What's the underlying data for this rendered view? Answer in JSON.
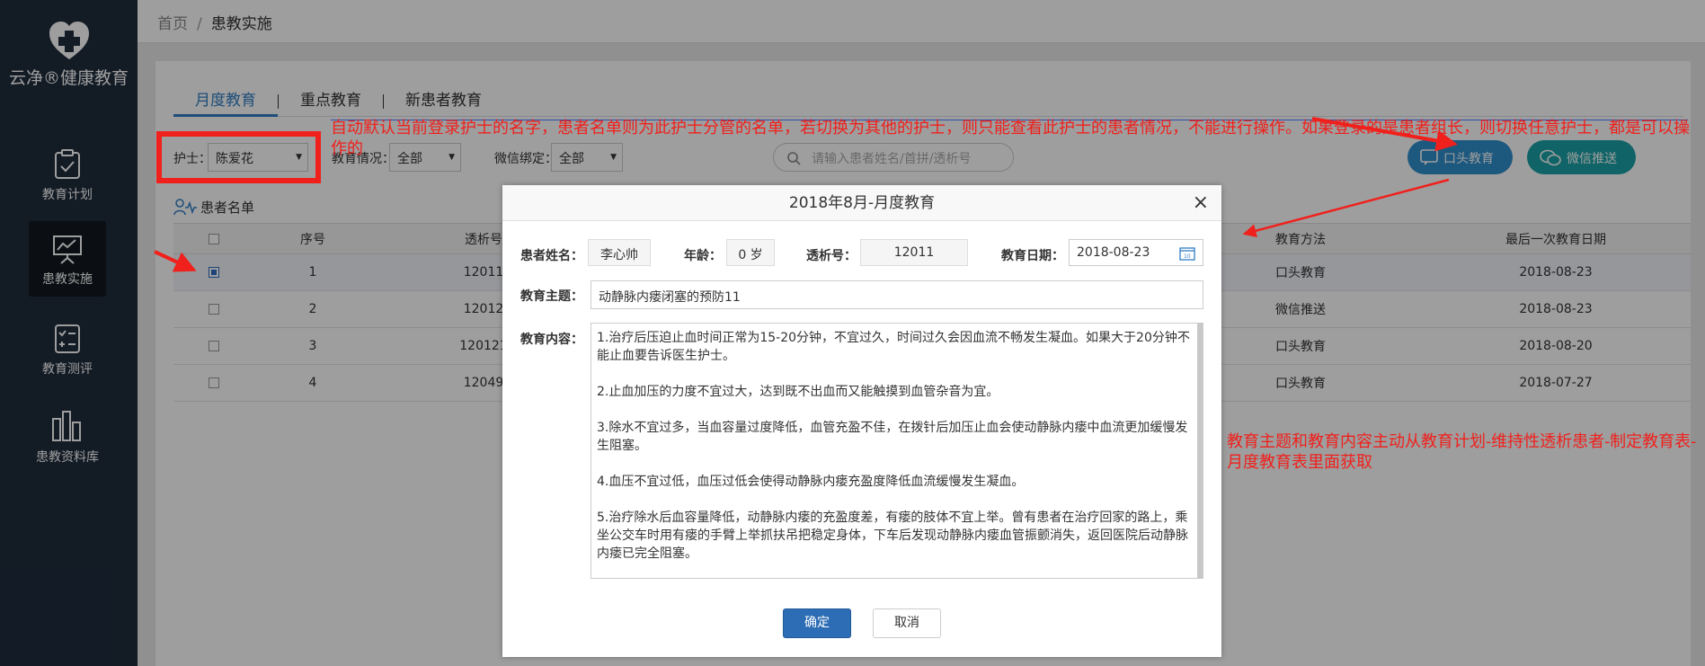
{
  "sidebar": {
    "brand": "云净®健康教育",
    "items": [
      {
        "label": "教育计划",
        "icon": "clipboard-check-icon"
      },
      {
        "label": "患教实施",
        "icon": "presentation-chart-icon"
      },
      {
        "label": "教育测评",
        "icon": "checklist-icon"
      },
      {
        "label": "患教资料库",
        "icon": "books-icon"
      }
    ],
    "active_index": 1
  },
  "breadcrumb": {
    "home": "首页",
    "sep": "/",
    "current": "患教实施"
  },
  "tabs": [
    "月度教育",
    "重点教育",
    "新患者教育"
  ],
  "filters": {
    "nurse_label": "护士：",
    "nurse_value": "陈爱花",
    "edu_label": "教育情况：",
    "edu_value": "全部",
    "wechat_label": "微信绑定：",
    "wechat_value": "全部",
    "search_placeholder": "请输入患者姓名/首拼/透析号"
  },
  "actions": {
    "oral": "口头教育",
    "wechat": "微信推送"
  },
  "list": {
    "title": "患者名单",
    "headers": [
      "序号",
      "透析号",
      "教育方法",
      "最后一次教育日期"
    ],
    "rows": [
      {
        "no": "1",
        "id": "12011",
        "method": "口头教育",
        "date": "2018-08-23",
        "checked": true
      },
      {
        "no": "2",
        "id": "12012",
        "method": "微信推送",
        "date": "2018-08-23",
        "checked": false
      },
      {
        "no": "3",
        "id": "120121",
        "method": "口头教育",
        "date": "2018-08-20",
        "checked": false
      },
      {
        "no": "4",
        "id": "12049",
        "method": "口头教育",
        "date": "2018-07-27",
        "checked": false
      }
    ]
  },
  "annotations": {
    "top": "自动默认当前登录护士的名字，患者名单则为此护士分管的名单，若切换为其他的护士，则只能查看此护士的患者情况，不能进行操作。如果登录的是患者组长，则切换任意护士，都是可以操作的",
    "right": "教育主题和教育内容主动从教育计划-维持性透析患者-制定教育表-月度教育表里面获取"
  },
  "modal": {
    "title": "2018年8月-月度教育",
    "name_label": "患者姓名：",
    "name_value": "李心帅",
    "age_label": "年龄：",
    "age_value": "0 岁",
    "dialysis_label": "透析号：",
    "dialysis_value": "12011",
    "date_label": "教育日期：",
    "date_value": "2018-08-23",
    "topic_label": "教育主题：",
    "topic_value": "动静脉内瘘闭塞的预防11",
    "content_label": "教育内容：",
    "content": [
      "1.治疗后压迫止血时间正常为15-20分钟，不宜过久，时间过久会因血流不畅发生凝血。如果大于20分钟不能止血要告诉医生护士。",
      "2.止血加压的力度不宜过大，达到既不出血而又能触摸到血管杂音为宜。",
      "3.除水不宜过多，当血容量过度降低，血管充盈不佳，在拨针后加压止血会使动静脉内瘘中血流更加缓慢发生阻塞。",
      "4.血压不宜过低，血压过低会使得动静脉内瘘充盈度降低血流缓慢发生凝血。",
      "5.治疗除水后血容量降低，动静脉内瘘的充盈度差，有瘘的肢体不宜上举。曾有患者在治疗回家的路上，乘坐公交车时用有瘘的手臂上举抓扶吊把稳定身体，下车后发现动静脉内瘘血管振颤消失，返回医院后动静脉内瘘已完全阻塞。"
    ],
    "ok": "确定",
    "cancel": "取消"
  },
  "colors": {
    "sidebar": "#1f2d3d",
    "accent": "#2f7cc3",
    "annotation": "#f0201c",
    "wechat_btn": "#1ba2a6"
  }
}
